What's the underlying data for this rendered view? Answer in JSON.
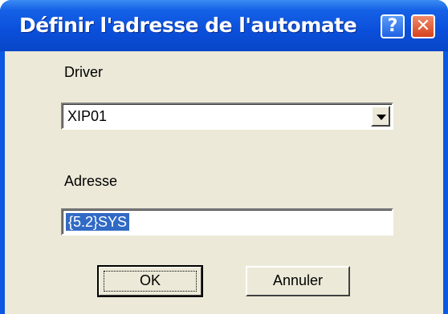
{
  "window": {
    "title": "Définir l'adresse de l'automate",
    "help_button": "?",
    "close_button": "✕"
  },
  "driver": {
    "label": "Driver",
    "value": "XIP01"
  },
  "adresse": {
    "label": "Adresse",
    "value": "{5.2}SYS"
  },
  "buttons": {
    "ok": "OK",
    "cancel": "Annuler"
  },
  "colors": {
    "titlebar": "#0a4fdb",
    "client": "#ece9d8",
    "selection": "#316ac5",
    "close": "#d6421d"
  }
}
